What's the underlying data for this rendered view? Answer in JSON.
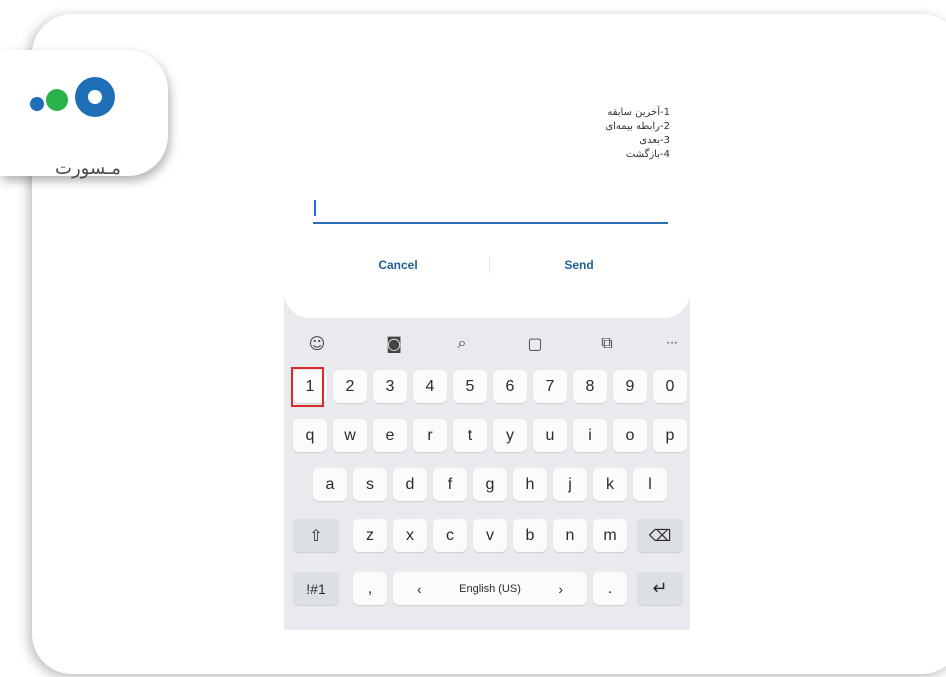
{
  "logo": {
    "text": "مـسورت"
  },
  "dialog": {
    "lines": [
      "1-آخرین سابقه",
      "2-رابطه بیمه‌ای",
      "3-بعدی",
      "4-بازگشت"
    ],
    "input_value": "",
    "cancel_label": "Cancel",
    "send_label": "Send"
  },
  "keyboard": {
    "toolbar": [
      {
        "name": "emoji-icon",
        "glyph": "☺"
      },
      {
        "name": "sticker-icon",
        "glyph": "◙"
      },
      {
        "name": "search-icon",
        "glyph": "⌕"
      },
      {
        "name": "clipboard-icon",
        "glyph": "▢"
      },
      {
        "name": "translate-icon",
        "glyph": "⧉"
      },
      {
        "name": "more-icon",
        "glyph": "···"
      }
    ],
    "number_row": [
      "1",
      "2",
      "3",
      "4",
      "5",
      "6",
      "7",
      "8",
      "9",
      "0"
    ],
    "row_q": [
      "q",
      "w",
      "e",
      "r",
      "t",
      "y",
      "u",
      "i",
      "o",
      "p"
    ],
    "row_a": [
      "a",
      "s",
      "d",
      "f",
      "g",
      "h",
      "j",
      "k",
      "l"
    ],
    "row_z": [
      "z",
      "x",
      "c",
      "v",
      "b",
      "n",
      "m"
    ],
    "shift": "⇧",
    "backspace": "⌫",
    "symbols": "!#1",
    "comma": ",",
    "space_label": "English (US)",
    "space_left": "‹",
    "space_right": "›",
    "period": ".",
    "enter": "↵",
    "highlighted_key": "1"
  },
  "colors": {
    "accent_blue": "#1f5f99",
    "logo_blue": "#1e6fb8",
    "logo_green": "#29b34a",
    "highlight_red": "#d82a2a"
  }
}
